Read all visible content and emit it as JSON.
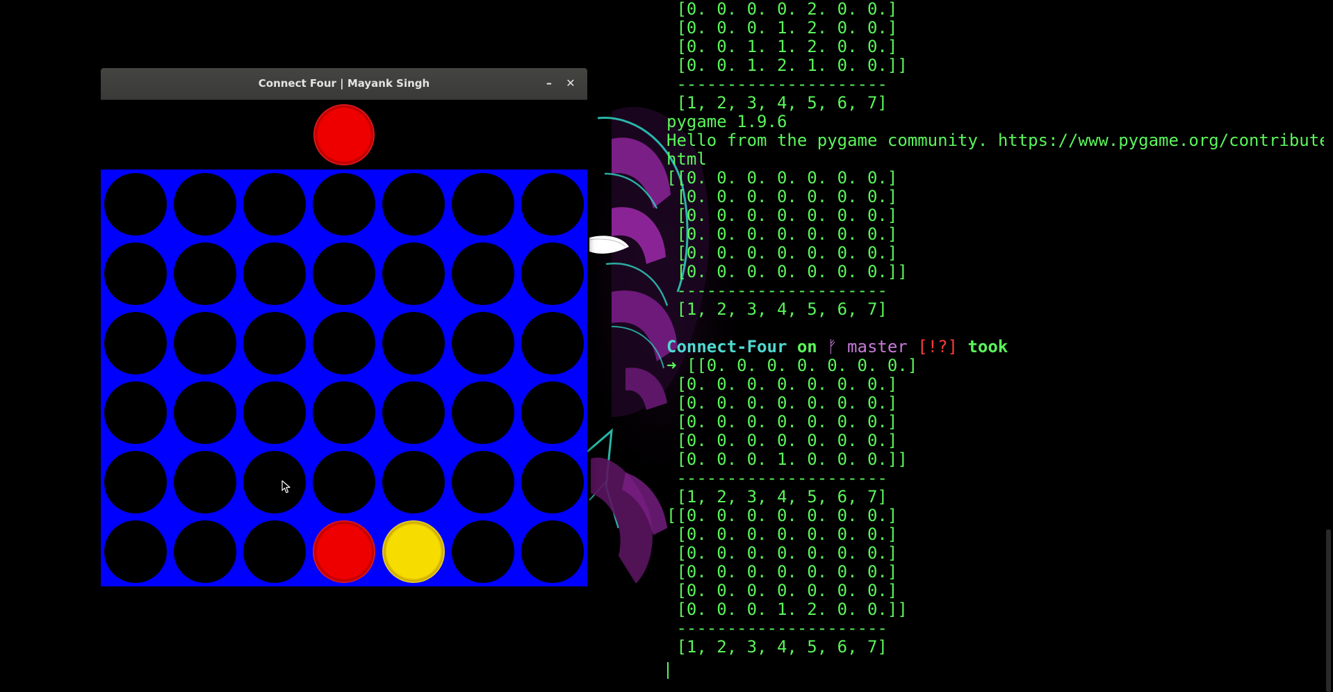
{
  "colors": {
    "terminal_text": "#5af55a",
    "prompt_dir": "#4fd9d0",
    "prompt_branch": "#c77bd8",
    "prompt_status": "#ff3b3b",
    "board": "#0000ff",
    "empty_slot": "#000000",
    "player1_piece": "#ee0000",
    "player2_piece": "#f7dc00"
  },
  "game_window": {
    "title": "Connect Four | Mayank Singh",
    "minimize_label": "–",
    "close_label": "✕",
    "hover_piece": {
      "color": "red",
      "column": 3
    },
    "board": {
      "rows": 6,
      "cols": 7,
      "cells": [
        [
          0,
          0,
          0,
          0,
          0,
          0,
          0
        ],
        [
          0,
          0,
          0,
          0,
          0,
          0,
          0
        ],
        [
          0,
          0,
          0,
          0,
          0,
          0,
          0
        ],
        [
          0,
          0,
          0,
          0,
          0,
          0,
          0
        ],
        [
          0,
          0,
          0,
          0,
          0,
          0,
          0
        ],
        [
          0,
          0,
          0,
          1,
          2,
          0,
          0
        ]
      ]
    }
  },
  "terminal": {
    "lines": [
      [
        {
          "text": " [0. 0. 0. 0. 2. 0. 0.]"
        }
      ],
      [
        {
          "text": " [0. 0. 0. 1. 2. 0. 0.]"
        }
      ],
      [
        {
          "text": " [0. 0. 1. 1. 2. 0. 0.]"
        }
      ],
      [
        {
          "text": " [0. 0. 1. 2. 1. 0. 0.]]"
        }
      ],
      [
        {
          "text": " ---------------------"
        }
      ],
      [
        {
          "text": " [1, 2, 3, 4, 5, 6, 7]"
        }
      ],
      [
        {
          "text": "pygame 1.9.6"
        }
      ],
      [
        {
          "text": "Hello from the pygame community. https://www.pygame.org/contribute."
        }
      ],
      [
        {
          "text": "html"
        }
      ],
      [
        {
          "text": "[[0. 0. 0. 0. 0. 0. 0.]"
        }
      ],
      [
        {
          "text": " [0. 0. 0. 0. 0. 0. 0.]"
        }
      ],
      [
        {
          "text": " [0. 0. 0. 0. 0. 0. 0.]"
        }
      ],
      [
        {
          "text": " [0. 0. 0. 0. 0. 0. 0.]"
        }
      ],
      [
        {
          "text": " [0. 0. 0. 0. 0. 0. 0.]"
        }
      ],
      [
        {
          "text": " [0. 0. 0. 0. 0. 0. 0.]]"
        }
      ],
      [
        {
          "text": " ---------------------"
        }
      ],
      [
        {
          "text": " [1, 2, 3, 4, 5, 6, 7]"
        }
      ],
      [
        {
          "text": ""
        }
      ],
      [
        {
          "text": "Connect-Four",
          "cls": "pr-dir"
        },
        {
          "text": " on ",
          "cls": "pr-on"
        },
        {
          "text": "ᚠ",
          "cls": "pr-branch-icon"
        },
        {
          "text": " master",
          "cls": "pr-branch"
        },
        {
          "text": " [!?]",
          "cls": "pr-status"
        },
        {
          "text": " took",
          "cls": "pr-took"
        }
      ],
      [
        {
          "text": "➜ ",
          "cls": "pr-arrow"
        },
        {
          "text": "[[0. 0. 0. 0. 0. 0. 0.]"
        }
      ],
      [
        {
          "text": " [0. 0. 0. 0. 0. 0. 0.]"
        }
      ],
      [
        {
          "text": " [0. 0. 0. 0. 0. 0. 0.]"
        }
      ],
      [
        {
          "text": " [0. 0. 0. 0. 0. 0. 0.]"
        }
      ],
      [
        {
          "text": " [0. 0. 0. 0. 0. 0. 0.]"
        }
      ],
      [
        {
          "text": " [0. 0. 0. 1. 0. 0. 0.]]"
        }
      ],
      [
        {
          "text": " ---------------------"
        }
      ],
      [
        {
          "text": " [1, 2, 3, 4, 5, 6, 7]"
        }
      ],
      [
        {
          "text": "[[0. 0. 0. 0. 0. 0. 0.]"
        }
      ],
      [
        {
          "text": " [0. 0. 0. 0. 0. 0. 0.]"
        }
      ],
      [
        {
          "text": " [0. 0. 0. 0. 0. 0. 0.]"
        }
      ],
      [
        {
          "text": " [0. 0. 0. 0. 0. 0. 0.]"
        }
      ],
      [
        {
          "text": " [0. 0. 0. 0. 0. 0. 0.]"
        }
      ],
      [
        {
          "text": " [0. 0. 0. 1. 2. 0. 0.]]"
        }
      ],
      [
        {
          "text": " ---------------------"
        }
      ],
      [
        {
          "text": " [1, 2, 3, 4, 5, 6, 7]"
        }
      ]
    ]
  }
}
